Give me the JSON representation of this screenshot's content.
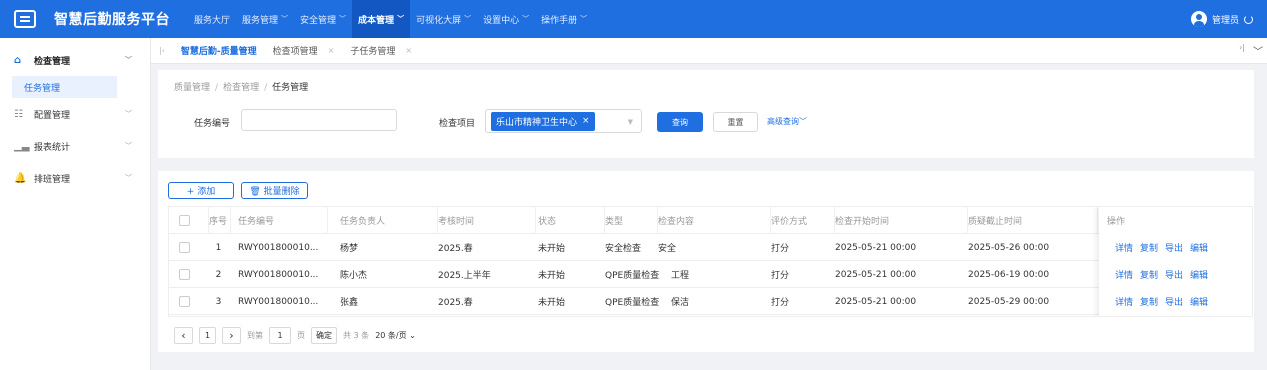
{
  "app": {
    "title": "智慧后勤服务平台",
    "menu_icon": "menu-icon"
  },
  "nav": [
    {
      "label": "服务大厅",
      "chev": ""
    },
    {
      "label": "服务管理",
      "chev": "﹀"
    },
    {
      "label": "安全管理",
      "chev": "﹀"
    },
    {
      "label": "成本管理",
      "chev": "﹀"
    },
    {
      "label": "可视化大屏",
      "chev": "﹀"
    },
    {
      "label": "设置中心",
      "chev": "﹀"
    },
    {
      "label": "操作手册",
      "chev": "﹀"
    }
  ],
  "user": {
    "name": "管理员"
  },
  "sidebar": {
    "groups": [
      {
        "label": "检查管理",
        "icon": "⌂",
        "caret": "﹀"
      },
      {
        "label": "配置管理",
        "icon": "☷",
        "caret": "﹀"
      },
      {
        "label": "报表统计",
        "icon": "▁▃",
        "caret": "﹀"
      },
      {
        "label": "排班管理",
        "icon": "🔔",
        "caret": "﹀"
      }
    ],
    "sub_active": "任务管理"
  },
  "tabs": [
    {
      "label": "智慧后勤-质量管理",
      "close": ""
    },
    {
      "label": "检查项管理",
      "close": "×"
    },
    {
      "label": "子任务管理",
      "close": "×"
    }
  ],
  "breadcrumb": {
    "items": [
      "质量管理",
      "检查管理"
    ],
    "current": "任务管理",
    "sep": "/"
  },
  "filter": {
    "task_no_label": "任务编号",
    "task_no_value": "",
    "check_item_label": "检查项目",
    "check_item_tag": "乐山市精神卫生中心",
    "tag_close": "×",
    "query": "查询",
    "reset": "重置",
    "advanced": "高级查询﹀"
  },
  "toolbar": {
    "add": "+ 添加",
    "batch_delete": "🗑 批量删除"
  },
  "table": {
    "headers": [
      "序号",
      "任务编号",
      "任务负责人",
      "考核时间",
      "状态",
      "类型",
      "检查内容",
      "评价方式",
      "检查开始时间",
      "质疑截止时间",
      "操作"
    ],
    "rows": [
      {
        "no": "1",
        "task_no": "RWY001800010...",
        "owner": "杨梦",
        "period": "2025.春",
        "status": "未开始",
        "type": "安全检查",
        "content": "安全",
        "method": "打分",
        "start": "2025-05-21 00:00",
        "deadline": "2025-05-26 00:00"
      },
      {
        "no": "2",
        "task_no": "RWY001800010...",
        "owner": "陈小杰",
        "period": "2025.上半年",
        "status": "未开始",
        "type": "QPE质量检查",
        "content": "工程",
        "method": "打分",
        "start": "2025-05-21 00:00",
        "deadline": "2025-06-19 00:00"
      },
      {
        "no": "3",
        "task_no": "RWY001800010...",
        "owner": "张鑫",
        "period": "2025.春",
        "status": "未开始",
        "type": "QPE质量检查",
        "content": "保洁",
        "method": "打分",
        "start": "2025-05-21 00:00",
        "deadline": "2025-05-29 00:00"
      }
    ],
    "actions": [
      "详情",
      "复制",
      "导出",
      "编辑"
    ]
  },
  "pager": {
    "prev": "‹",
    "page": "1",
    "next": "›",
    "goto": "到第",
    "goto_value": "1",
    "page_unit": "页",
    "confirm": "确定",
    "total": "共 3 条",
    "page_size": "20 条/页"
  }
}
